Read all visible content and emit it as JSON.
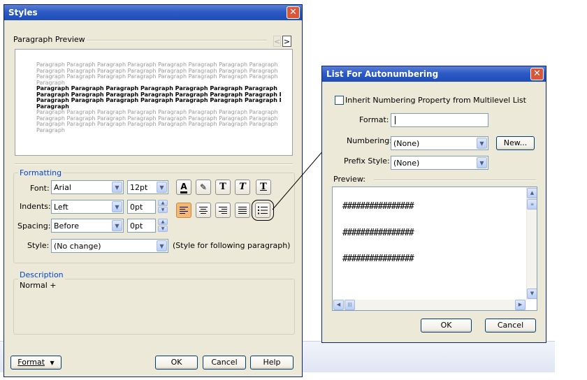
{
  "styles_dialog": {
    "title": "Styles",
    "close_glyph": "✕",
    "paragraph_preview_label": "Paragraph Preview",
    "prev_arrow": "<",
    "next_arrow": ">",
    "preview_word": "Paragraph",
    "formatting": {
      "group_label": "Formatting",
      "font_label": "Font:",
      "font_value": "Arial",
      "size_value": "12pt",
      "indents_label": "Indents:",
      "indents_value": "Left",
      "indents_amount": "0pt",
      "spacing_label": "Spacing:",
      "spacing_value": "Before",
      "spacing_amount": "0pt",
      "style_label": "Style:",
      "style_value": "(No change)",
      "style_note": "(Style for following paragraph)",
      "tool_icons": [
        "font-color-icon",
        "highlight-icon",
        "bold-icon",
        "italic-icon",
        "underline-icon"
      ],
      "align_icons": [
        "align-left-icon",
        "align-center-icon",
        "align-right-icon",
        "justify-icon",
        "bullet-list-icon"
      ]
    },
    "description": {
      "group_label": "Description",
      "text": "Normal +"
    },
    "buttons": {
      "format": "Format",
      "ok": "OK",
      "cancel": "Cancel",
      "help": "Help"
    }
  },
  "autonumber_dialog": {
    "title": "List For Autonumbering",
    "close_glyph": "✕",
    "inherit_checkbox_label": "Inherit Numbering Property from Multilevel List",
    "inherit_checked": false,
    "format_label": "Format:",
    "format_value": "",
    "numbering_label": "Numbering:",
    "numbering_value": "(None)",
    "new_button": "New...",
    "prefix_label": "Prefix Style:",
    "prefix_value": "(None)",
    "preview_label": "Preview:",
    "preview_lines": [
      "################",
      "################",
      "################"
    ],
    "ok": "OK",
    "cancel": "Cancel"
  },
  "colors": {
    "title_blue": "#2d5bc6",
    "group_label_blue": "#0046d5",
    "selected_button_orange": "#f3b777",
    "dialog_face": "#ece9d8"
  }
}
